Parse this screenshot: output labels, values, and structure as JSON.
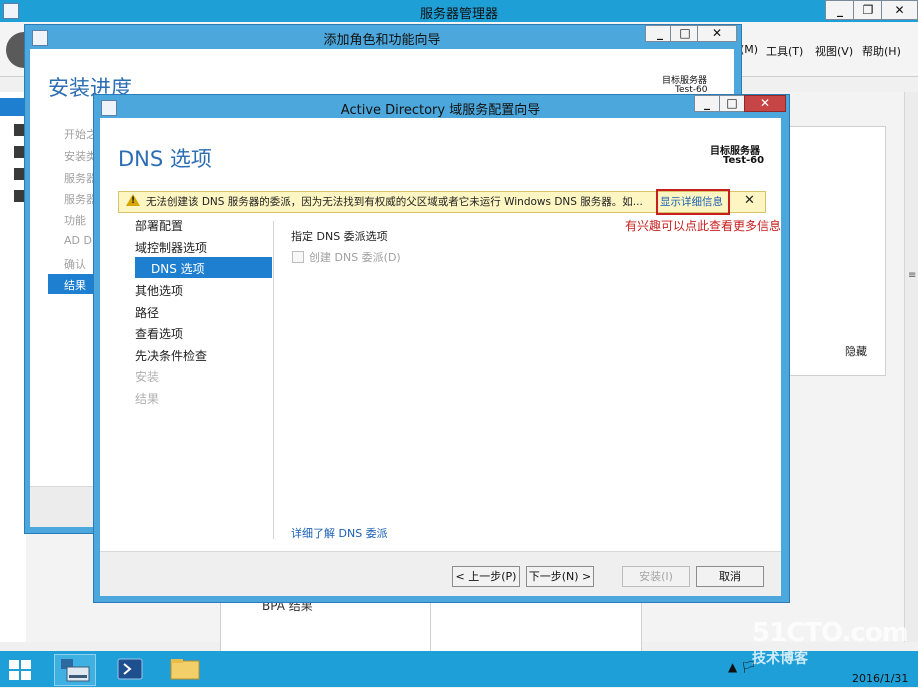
{
  "server_manager": {
    "title": "服务器管理器",
    "menus": [
      "(M)",
      "工具(T)",
      "视图(V)",
      "帮助(H)"
    ],
    "window_controls": [
      "_",
      "❐",
      "✕"
    ],
    "right_panel_hide": "隐藏",
    "bottom_panel_label": "BPA 结果"
  },
  "add_roles_wizard": {
    "title": "添加角色和功能向导",
    "heading": "安装进度",
    "target_label": "目标服务器",
    "target_value": "Test-60",
    "steps": [
      "开始之",
      "安装类",
      "服务器",
      "服务器",
      "功能",
      "AD D",
      "确认",
      "结果"
    ],
    "window_controls": [
      "_",
      "□",
      "✕"
    ]
  },
  "ad_wizard": {
    "title": "Active Directory 域服务配置向导",
    "heading": "DNS 选项",
    "target_label": "目标服务器",
    "target_value": "Test-60",
    "window_controls": [
      "_",
      "□",
      "✕"
    ],
    "warning": {
      "text": "无法创建该 DNS 服务器的委派，因为无法找到有权威的父区域或者它未运行 Windows DNS 服务器。如...",
      "link": "显示详细信息",
      "close": "✕"
    },
    "annotation": "有兴趣可以点此查看更多信息",
    "nav": {
      "items": [
        "部署配置",
        "域控制器选项",
        "DNS 选项",
        "其他选项",
        "路径",
        "查看选项",
        "先决条件检查",
        "安装",
        "结果"
      ],
      "selected": "DNS 选项"
    },
    "section_label": "指定 DNS 委派选项",
    "checkbox_label": "创建 DNS 委派(D)",
    "learn_more": "详细了解 DNS 委派",
    "buttons": {
      "prev": "< 上一步(P)",
      "next": "下一步(N) >",
      "install": "安装(I)",
      "cancel": "取消"
    }
  },
  "taskbar": {
    "tray_text": "▲ 🏳",
    "date": "2016/1/31",
    "watermark": "51CTO.com",
    "watermark_sub": "技术博客"
  },
  "colors": {
    "accent": "#1e7fd0",
    "titlebar": "#4ca8dc",
    "warning_bg": "#fdf6c3",
    "annotation": "#c81e1e"
  }
}
